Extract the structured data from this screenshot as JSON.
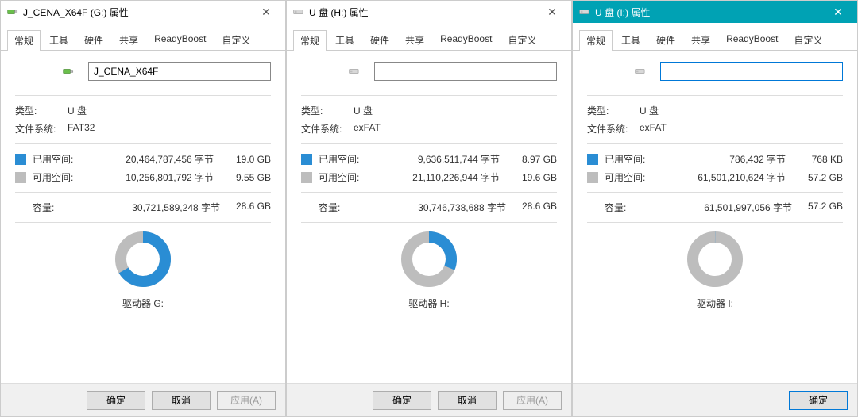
{
  "tabs": {
    "general": "常规",
    "tools": "工具",
    "hardware": "硬件",
    "sharing": "共享",
    "readyboost": "ReadyBoost",
    "custom": "自定义"
  },
  "labels": {
    "type": "类型:",
    "filesystem": "文件系统:",
    "used": "已用空间:",
    "free": "可用空间:",
    "capacity": "容量:",
    "bytes_suffix": "字节"
  },
  "buttons": {
    "ok": "确定",
    "cancel": "取消",
    "apply": "应用(A)"
  },
  "colors": {
    "used": "#2a8dd4",
    "free": "#bdbdbd"
  },
  "chart_data": [
    {
      "type": "pie",
      "title": "驱动器 G:",
      "series": [
        {
          "name": "已用空间",
          "value": 20464787456
        },
        {
          "name": "可用空间",
          "value": 10256801792
        }
      ]
    },
    {
      "type": "pie",
      "title": "驱动器 H:",
      "series": [
        {
          "name": "已用空间",
          "value": 9636511744
        },
        {
          "name": "可用空间",
          "value": 21110226944
        }
      ]
    },
    {
      "type": "pie",
      "title": "驱动器 I:",
      "series": [
        {
          "name": "已用空间",
          "value": 786432
        },
        {
          "name": "可用空间",
          "value": 61501210624
        }
      ]
    }
  ],
  "windows": [
    {
      "title": "J_CENA_X64F (G:) 属性",
      "icon": "usb-green",
      "name": "J_CENA_X64F",
      "type": "U 盘",
      "fs": "FAT32",
      "used_bytes": "20,464,787,456 字节",
      "used_hr": "19.0 GB",
      "free_bytes": "10,256,801,792 字节",
      "free_hr": "9.55 GB",
      "cap_bytes": "30,721,589,248 字节",
      "cap_hr": "28.6 GB",
      "drive": "驱动器 G:",
      "used_pct": 66.6,
      "buttons_mode": "three"
    },
    {
      "title": "U 盘 (H:) 属性",
      "icon": "drive-gray",
      "name": "",
      "type": "U 盘",
      "fs": "exFAT",
      "used_bytes": "9,636,511,744 字节",
      "used_hr": "8.97 GB",
      "free_bytes": "21,110,226,944 字节",
      "free_hr": "19.6 GB",
      "cap_bytes": "30,746,738,688 字节",
      "cap_hr": "28.6 GB",
      "drive": "驱动器 H:",
      "used_pct": 31.3,
      "buttons_mode": "three"
    },
    {
      "title": "U 盘 (I:) 属性",
      "icon": "drive-gray",
      "teal": true,
      "name": "",
      "type": "U 盘",
      "fs": "exFAT",
      "used_bytes": "786,432 字节",
      "used_hr": "768 KB",
      "free_bytes": "61,501,210,624 字节",
      "free_hr": "57.2 GB",
      "cap_bytes": "61,501,997,056 字节",
      "cap_hr": "57.2 GB",
      "drive": "驱动器 I:",
      "used_pct": 0.1,
      "buttons_mode": "one"
    }
  ]
}
